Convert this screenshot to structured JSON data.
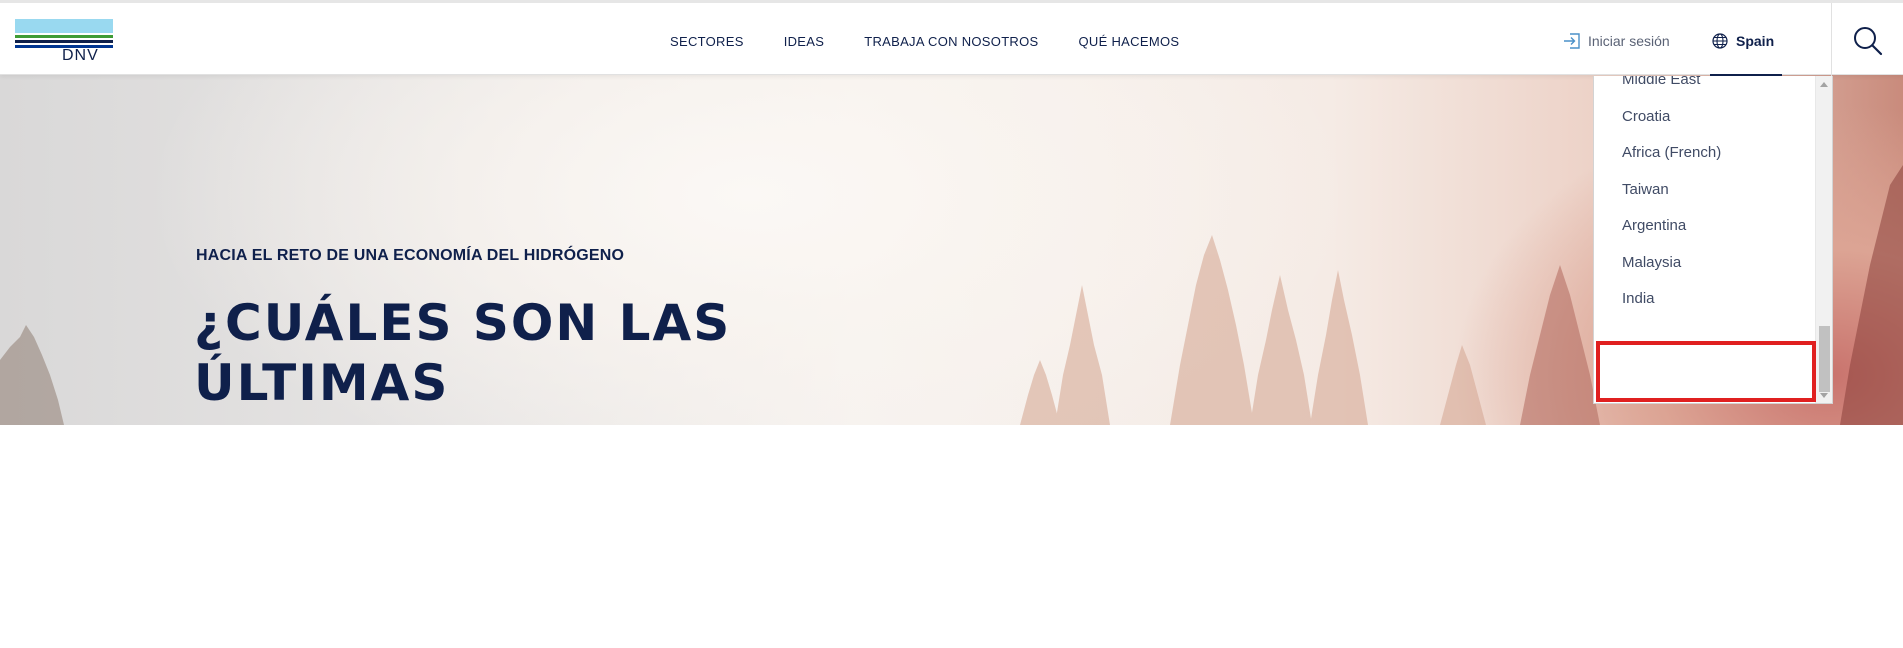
{
  "header": {
    "logo_text": "DNV",
    "nav": [
      {
        "label": "SECTORES"
      },
      {
        "label": "IDEAS"
      },
      {
        "label": "TRABAJA CON NOSOTROS"
      },
      {
        "label": "QUÉ HACEMOS"
      }
    ],
    "login_label": "Iniciar sesión",
    "locale_label": "Spain"
  },
  "hero": {
    "kicker": "HACIA EL RETO DE UNA ECONOMÍA DEL HIDRÓGENO",
    "title": "¿CUÁLES SON LAS ÚLTIMAS"
  },
  "locale_dropdown": {
    "items": [
      {
        "label": "Middle East"
      },
      {
        "label": "Croatia"
      },
      {
        "label": "Africa (French)"
      },
      {
        "label": "Taiwan"
      },
      {
        "label": "Argentina"
      },
      {
        "label": "Malaysia"
      },
      {
        "label": "India"
      }
    ]
  },
  "colors": {
    "brand_navy": "#0f204b",
    "brand_sky": "#99d9f0",
    "brand_green": "#3f9c35",
    "highlight_red": "#e02020"
  },
  "icons": {
    "login": "sign-in-icon",
    "locale": "globe-icon",
    "search": "search-icon"
  }
}
